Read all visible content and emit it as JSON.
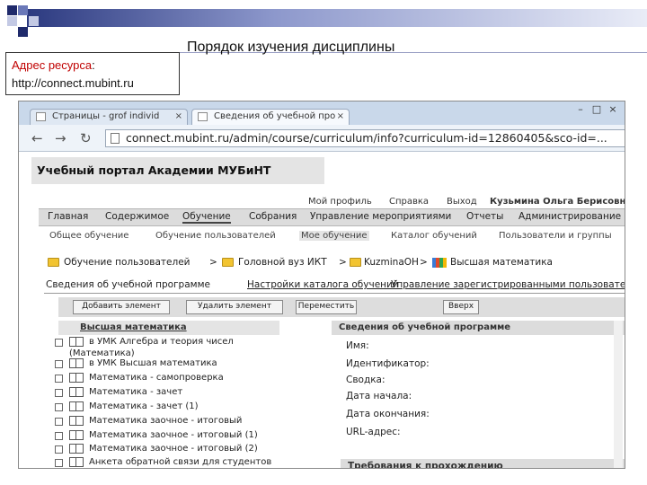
{
  "slide": {
    "title": "Порядок изучения дисциплины",
    "resource_label": "Адрес ресурса",
    "resource_colon": ":",
    "resource_url": "http://connect.mubint.ru"
  },
  "browser": {
    "tabs": [
      {
        "label": "Страницы - grof individ"
      },
      {
        "label": "Сведения об учебной про"
      }
    ],
    "url": "connect.mubint.ru/admin/course/curriculum/info?curriculum-id=12860405&sco-id=..."
  },
  "portal": {
    "title": "Учебный портал Академии МУБиНТ",
    "user_links": {
      "profile": "Мой профиль",
      "help": "Справка",
      "logout": "Выход",
      "user_name": "Кузьмина Ольга Берисовн"
    },
    "main_menu": [
      "Главная",
      "Содержимое",
      "Обучение",
      "Собрания",
      "Управление мероприятиями",
      "Отчеты",
      "Администрирование"
    ],
    "sub_menu": [
      "Общее обучение",
      "Обучение пользователей",
      "Мое обучение",
      "Каталог обучений",
      "Пользователи и группы"
    ],
    "breadcrumb": [
      "Обучение пользователей",
      "Головной вуз ИКТ",
      "KuzminaOH",
      "Высшая математика"
    ],
    "content_tabs": [
      "Сведения об учебной программе",
      "Настройки каталога обучений",
      "Управление зарегистрированными пользователями"
    ],
    "buttons": [
      "Добавить элемент",
      "Удалить элемент",
      "Переместить",
      "Вверх"
    ],
    "tree_title": "Высшая математика",
    "tree_items": [
      "в УМК Алгебра и теория чисел",
      "(Математика)",
      "в УМК Высшая математика",
      "Математика - самопроверка",
      "Математика - зачет",
      "Математика - зачет (1)",
      "Математика заочное - итоговый",
      "Математика заочное - итоговый (1)",
      "Математика заочное - итоговый (2)",
      "Анкета обратной связи для студентов"
    ],
    "details_title": "Сведения об учебной программе",
    "details_fields": [
      "Имя:",
      "Идентификатор:",
      "Сводка:",
      "Дата начала:",
      "Дата окончания:",
      "URL-адрес:"
    ],
    "requirements_title": "Требования к прохождению"
  }
}
